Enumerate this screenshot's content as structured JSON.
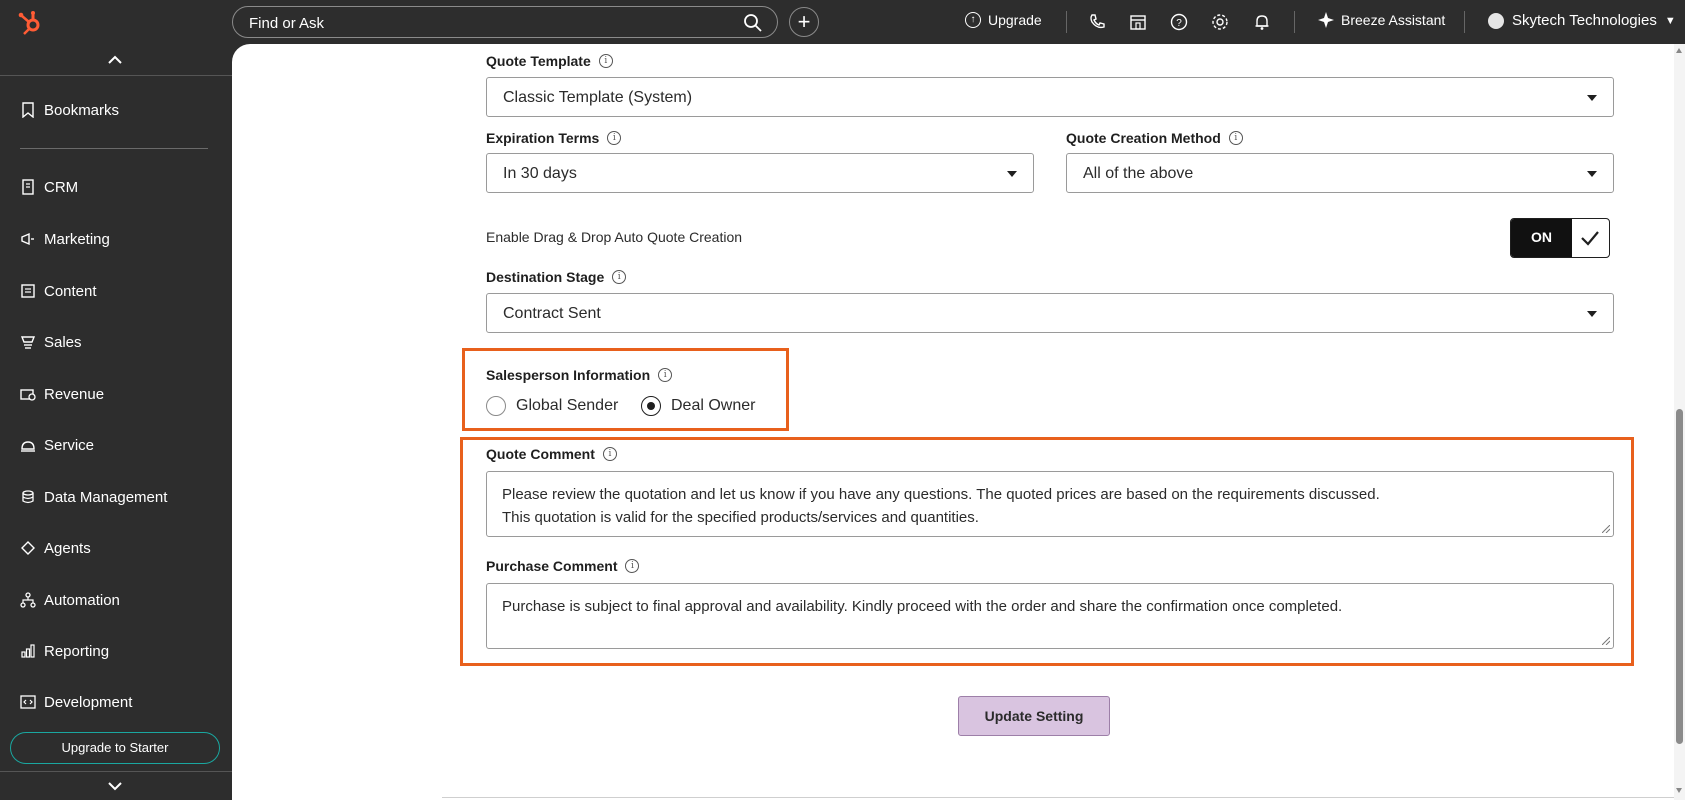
{
  "topbar": {
    "search_placeholder": "Find or Ask",
    "upgrade_label": "Upgrade",
    "breeze_label": "Breeze Assistant",
    "account_name": "Skytech Technologies"
  },
  "sidebar": {
    "bookmarks": "Bookmarks",
    "items": [
      "CRM",
      "Marketing",
      "Content",
      "Sales",
      "Revenue",
      "Service",
      "Data Management",
      "Agents",
      "Automation",
      "Reporting",
      "Development"
    ],
    "upgrade_label": "Upgrade to Starter"
  },
  "form": {
    "quote_template": {
      "label": "Quote Template",
      "value": "Classic Template (System)"
    },
    "expiration_terms": {
      "label": "Expiration Terms",
      "value": "In 30 days"
    },
    "quote_creation_method": {
      "label": "Quote Creation Method",
      "value": "All of the above"
    },
    "drag_drop": {
      "label": "Enable Drag & Drop Auto Quote Creation",
      "toggle_label": "ON"
    },
    "destination_stage": {
      "label": "Destination Stage",
      "value": "Contract Sent"
    },
    "salesperson_info": {
      "label": "Salesperson Information",
      "options": [
        "Global Sender",
        "Deal Owner"
      ],
      "selected": "Deal Owner"
    },
    "quote_comment": {
      "label": "Quote Comment",
      "line1": "Please review the quotation and let us know if you have any questions. The quoted prices are based on the requirements discussed.",
      "line2": "This quotation is valid for the specified products/services and quantities."
    },
    "purchase_comment": {
      "label": "Purchase Comment",
      "value": "Purchase is subject to final approval and availability. Kindly proceed with the order and share the confirmation once completed."
    },
    "submit_label": "Update Setting"
  },
  "colors": {
    "highlight": "#e8601c",
    "brand_logo": "#ff5c35",
    "button_bg": "#d9c4e0"
  }
}
